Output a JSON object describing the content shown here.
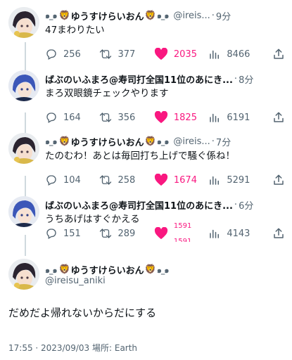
{
  "tweets": [
    {
      "name": "ゆうすけらいおん",
      "handle": "@ireis...",
      "time": "9分",
      "text": "47まわりたい",
      "reply": "256",
      "retweet": "377",
      "like": "2035",
      "views": "8466"
    },
    {
      "name": "ばぶのいふまろ@寿司打全国11位のあにき...",
      "handle": "",
      "time": "8分",
      "text": "まろ双眼鏡チェックやります",
      "reply": "164",
      "retweet": "356",
      "like": "1825",
      "views": "6191"
    },
    {
      "name": "ゆうすけらいおん",
      "handle": "@ireis...",
      "time": "7分",
      "text": "たのむわ！あとは毎回打ち上げで騒ぐ係ね！",
      "reply": "104",
      "retweet": "258",
      "like": "1674",
      "views": "5291"
    },
    {
      "name": "ばぶのいふまろ@寿司打全国11位のあにき...",
      "handle": "",
      "time": "6分",
      "text": "うちあげはすぐかえる",
      "reply": "151",
      "retweet": "289",
      "like_top": "1591",
      "like_bottom": "1591",
      "views": "4143"
    }
  ],
  "main": {
    "name": "ゆうすけらいおん",
    "handle": "@ireisu_aniki",
    "text": "だめだよ帰れないからだにする",
    "footer": "17:55 · 2023/09/03 場所: Earth"
  },
  "colors": {
    "like": "#f91880",
    "muted": "#536471",
    "text": "#0f1419",
    "thread_line": "#cfd9de"
  },
  "icons": [
    "reply-icon",
    "retweet-icon",
    "heart-icon",
    "views-icon",
    "share-icon",
    "lion-emoji",
    "swirl-deco"
  ]
}
